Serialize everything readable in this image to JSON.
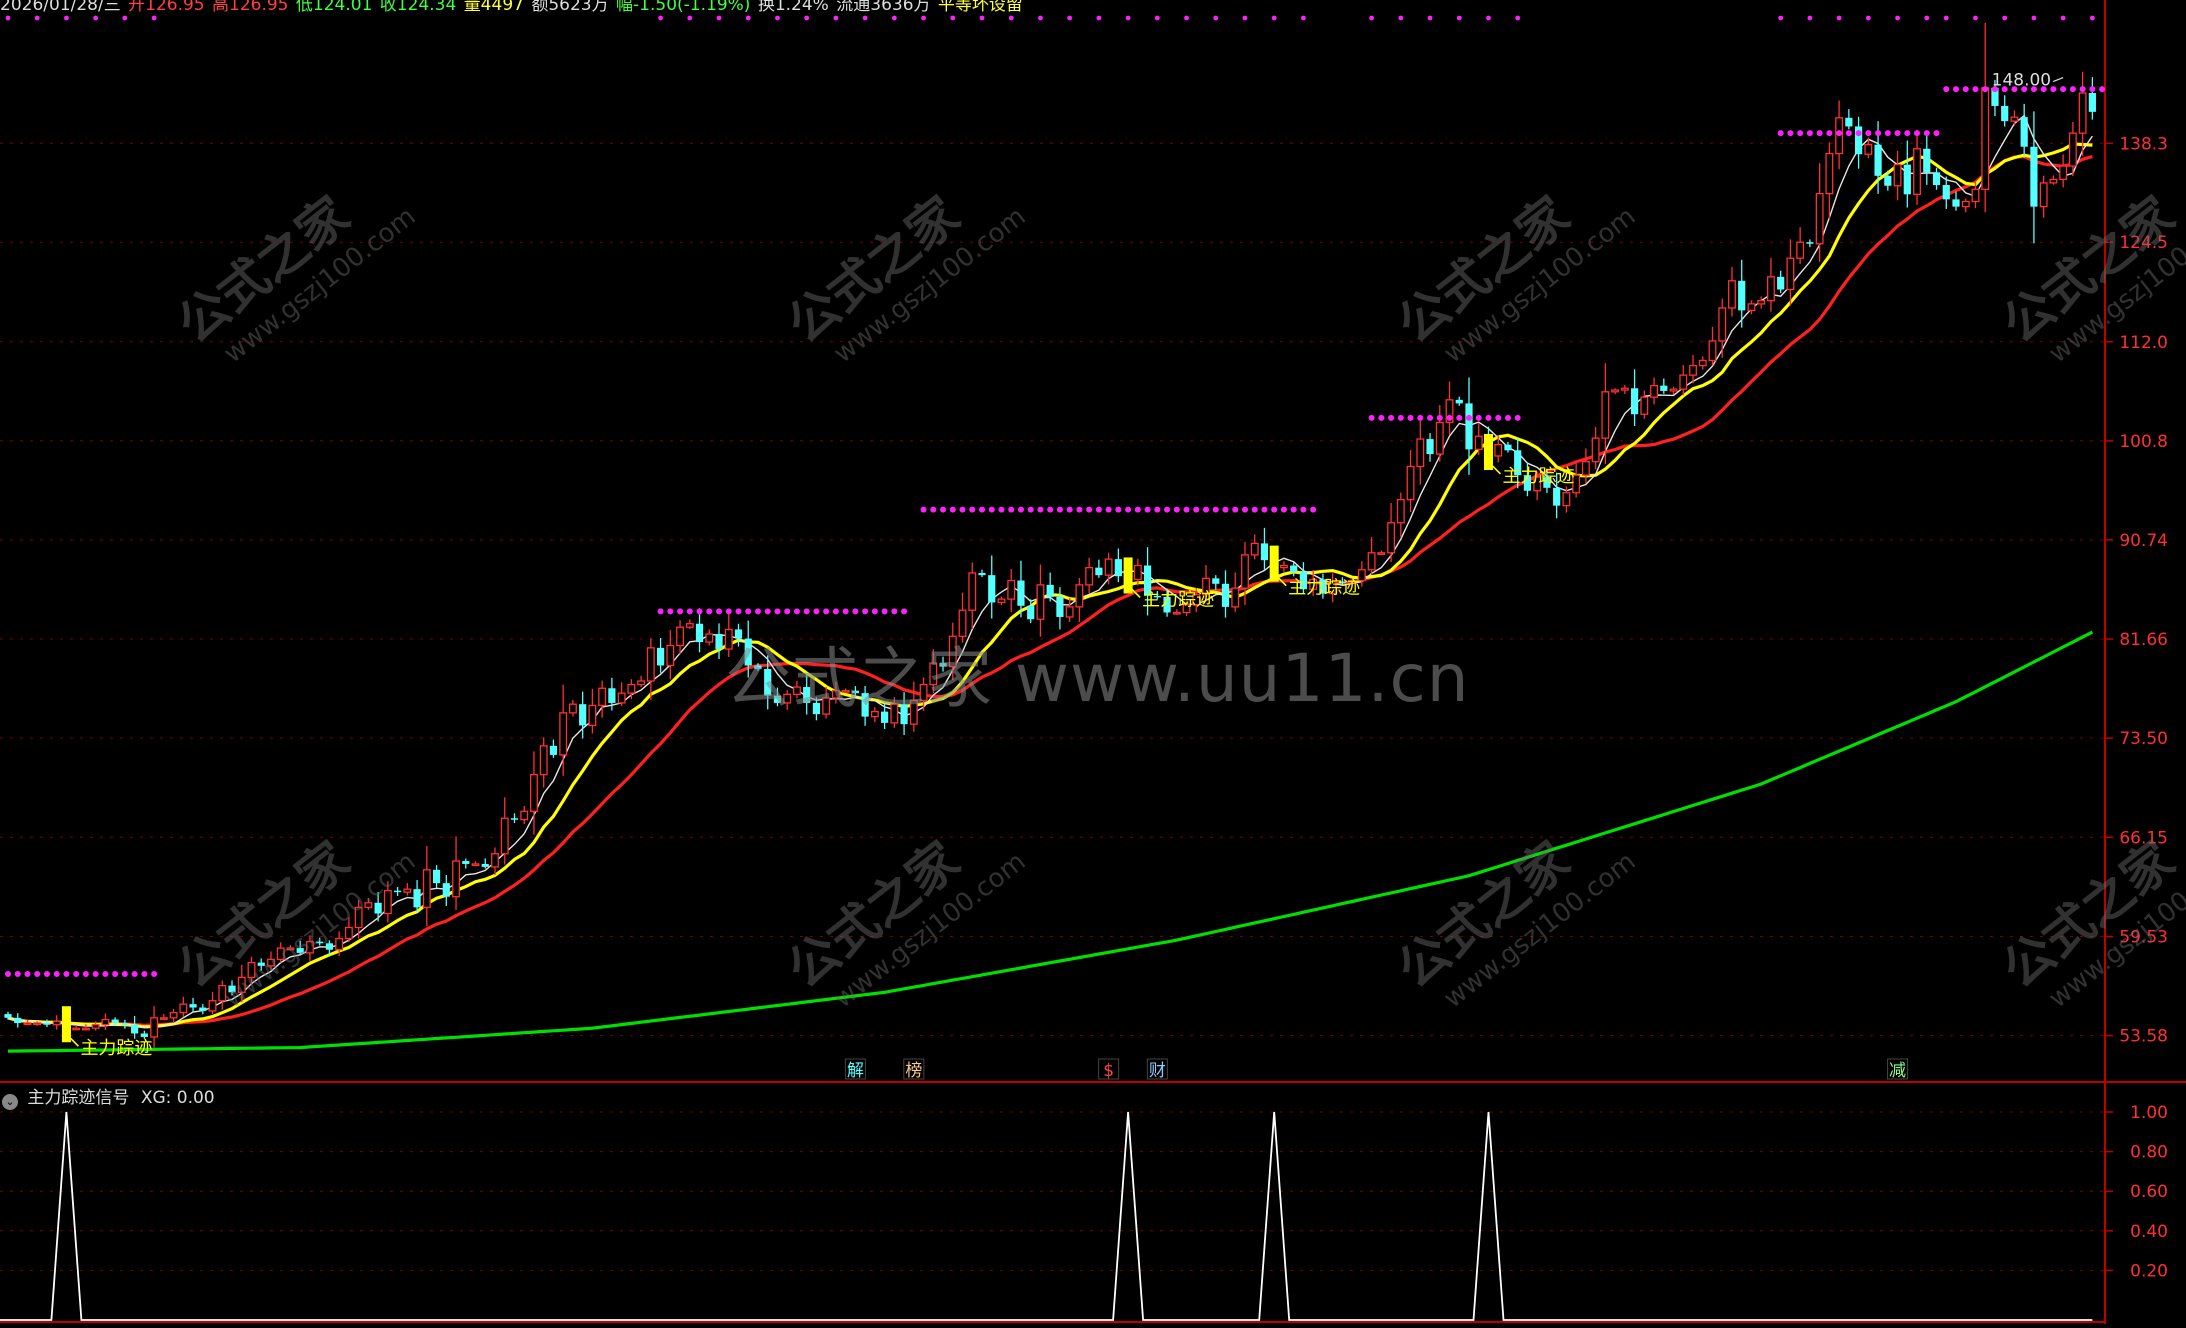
{
  "header": {
    "date": "2026/01/28/三",
    "open": "开126.95",
    "high": "高126.95",
    "low": "低124.01",
    "close": "收124.34",
    "volume": "量4497",
    "amount": "额5623万",
    "change": "幅-1.50(-1.19%)",
    "turnover": "换1.24%",
    "float": "流通3636万",
    "setting": "平等坏设留"
  },
  "colors": {
    "up": "#ff3030",
    "down": "#54ffff",
    "ma_white": "#e6e6e6",
    "ma_yellow": "#ffff00",
    "ma_red": "#ff2020",
    "ma_green": "#00e000",
    "resistance": "#ff20ff",
    "grid": "#7a0000",
    "axis": "#c00000",
    "label": "#ff3030",
    "signal": "#ffffff"
  },
  "main_panel": {
    "y_ticks": [
      "138.3",
      "124.5",
      "112.0",
      "100.8",
      "90.74",
      "81.66",
      "73.50",
      "66.15",
      "59.53",
      "53.58"
    ],
    "peak_label": "148.00",
    "event_marks": [
      {
        "text": "解",
        "color": "#5ff"
      },
      {
        "text": "榜",
        "color": "#fc8"
      },
      {
        "text": "$",
        "color": "#f44"
      },
      {
        "text": "财",
        "color": "#8cf"
      },
      {
        "text": "减",
        "color": "#8f8"
      }
    ],
    "signal_label": "主力踪迹"
  },
  "watermarks": {
    "center": "公式之家 www.uu11.cn",
    "cn": "公式之家",
    "url": "www.gszj100.com"
  },
  "sub_panel": {
    "title": "主力踪迹信号",
    "value_label": "XG: 0.00",
    "y_ticks": [
      "1.00",
      "0.80",
      "0.60",
      "0.40",
      "0.20"
    ]
  },
  "chart_data": [
    {
      "type": "candlestick",
      "title": "",
      "scale": "log",
      "ylim": [
        51.0,
        158.0
      ],
      "x": [
        0,
        1,
        2,
        3,
        4,
        5,
        6,
        7,
        8,
        9,
        10,
        11,
        12,
        13,
        14,
        15,
        16,
        17,
        18,
        19,
        20,
        21,
        22,
        23,
        24,
        25,
        26,
        27,
        28,
        29,
        30,
        31,
        32,
        33,
        34,
        35,
        36,
        37,
        38,
        39,
        40,
        41,
        42,
        43,
        44,
        45,
        46,
        47,
        48,
        49,
        50,
        51,
        52,
        53,
        54,
        55,
        56,
        57,
        58,
        59,
        60,
        61,
        62,
        63,
        64,
        65,
        66,
        67,
        68,
        69,
        70,
        71,
        72,
        73,
        74,
        75,
        76,
        77,
        78,
        79,
        80,
        81,
        82,
        83,
        84,
        85,
        86,
        87,
        88,
        89,
        90,
        91,
        92,
        93,
        94,
        95,
        96,
        97,
        98,
        99,
        100,
        101,
        102,
        103,
        104,
        105,
        106,
        107,
        108,
        109,
        110,
        111,
        112,
        113,
        114,
        115,
        116,
        117,
        118,
        119,
        120,
        121,
        122,
        123,
        124,
        125,
        126,
        127,
        128,
        129,
        130,
        131,
        132,
        133,
        134,
        135,
        136,
        137,
        138,
        139,
        140,
        141,
        142,
        143,
        144,
        145,
        146,
        147,
        148,
        149,
        150,
        151,
        152,
        153,
        154,
        155,
        156,
        157,
        158,
        159,
        160,
        161,
        162,
        163,
        164,
        165,
        166,
        167,
        168,
        169,
        170,
        171,
        172,
        173,
        174,
        175,
        176,
        177,
        178,
        179,
        180,
        181,
        182,
        183,
        184,
        185,
        186,
        187,
        188,
        189,
        190,
        191,
        192,
        193,
        194,
        195,
        196,
        197,
        198,
        199,
        200,
        201,
        202,
        203,
        204,
        205,
        206,
        207,
        208,
        209,
        210,
        211,
        212,
        213,
        214,
        215
      ],
      "close": [
        54.6,
        54.3,
        54.3,
        54.3,
        54.2,
        54.4,
        54.0,
        54.0,
        54.0,
        54.2,
        54.5,
        54.3,
        54.2,
        53.7,
        53.5,
        54.6,
        54.6,
        54.9,
        55.4,
        55.2,
        55.0,
        55.6,
        56.5,
        56.1,
        57.0,
        57.9,
        57.7,
        58.1,
        58.8,
        58.8,
        58.5,
        59.2,
        59.1,
        58.7,
        59.4,
        60.1,
        61.4,
        61.7,
        61.0,
        62.5,
        62.4,
        62.6,
        61.4,
        63.9,
        63.0,
        62.1,
        64.5,
        64.3,
        64.3,
        64.1,
        65.0,
        67.5,
        67.4,
        68.0,
        70.7,
        72.9,
        72.2,
        75.5,
        76.2,
        74.5,
        76.1,
        77.5,
        76.3,
        77.1,
        77.8,
        78.1,
        80.9,
        79.4,
        81.1,
        82.7,
        83.0,
        81.4,
        82.1,
        80.8,
        82.5,
        81.7,
        79.4,
        79.1,
        76.9,
        76.3,
        77.0,
        77.6,
        76.3,
        75.4,
        76.7,
        77.3,
        77.3,
        77.1,
        75.2,
        75.6,
        74.7,
        76.2,
        74.6,
        76.5,
        77.8,
        79.6,
        79.3,
        81.9,
        84.2,
        87.6,
        87.4,
        84.9,
        85.2,
        86.9,
        84.6,
        83.4,
        86.5,
        85.4,
        83.6,
        84.5,
        86.5,
        88.1,
        87.4,
        88.9,
        87.3,
        87.0,
        88.3,
        85.5,
        85.4,
        84.0,
        84.0,
        84.7,
        85.6,
        87.1,
        86.6,
        84.5,
        86.2,
        89.3,
        90.4,
        88.8,
        88.1,
        88.3,
        87.7,
        86.1,
        87.0,
        85.7,
        86.8,
        86.7,
        86.9,
        87.9,
        89.5,
        89.5,
        92.4,
        94.7,
        98.1,
        101.0,
        99.4,
        102.8,
        105.3,
        104.9,
        99.9,
        101.3,
        99.2,
        100.4,
        99.8,
        97.2,
        95.6,
        97.0,
        95.9,
        94.1,
        95.4,
        97.2,
        98.6,
        101.1,
        106.2,
        106.4,
        106.6,
        103.7,
        105.6,
        106.9,
        106.3,
        106.5,
        108.1,
        109.2,
        109.8,
        112.1,
        116.1,
        119.5,
        115.8,
        116.6,
        117.0,
        120.0,
        118.4,
        122.4,
        124.5,
        124.3,
        131.1,
        136.8,
        142.1,
        140.8,
        136.7,
        138.1,
        133.6,
        132.2,
        135.2,
        131.0,
        137.5,
        134.1,
        132.3,
        130.3,
        129.3,
        130.0,
        131.7,
        146.7,
        143.9,
        141.6,
        142.2,
        137.8,
        129.3,
        132.6,
        133.1,
        135.0,
        139.8,
        145.9,
        143.0
      ],
      "ma_white_period": 5,
      "ma_yellow_period": 10,
      "ma_red_period": 20,
      "ma_green": [
        [
          0,
          52.7
        ],
        [
          30,
          52.9
        ],
        [
          60,
          54.0
        ],
        [
          90,
          56.1
        ],
        [
          120,
          59.3
        ],
        [
          150,
          63.5
        ],
        [
          180,
          70.0
        ],
        [
          200,
          76.4
        ],
        [
          215,
          82.7
        ]
      ],
      "resistance_segments": [
        {
          "from": 0,
          "to": 15,
          "price": 57.2
        },
        {
          "from": 67,
          "to": 92,
          "price": 84.1
        },
        {
          "from": 94,
          "to": 134,
          "price": 93.7
        },
        {
          "from": 140,
          "to": 155,
          "price": 103.3
        },
        {
          "from": 182,
          "to": 198,
          "price": 139.8
        },
        {
          "from": 199,
          "to": 215,
          "price": 146.5
        }
      ],
      "signals": [
        6,
        115,
        130,
        152
      ],
      "peak": {
        "index": 211,
        "price": 148.0
      },
      "event_mark_indices": [
        87,
        93,
        113,
        118,
        194
      ]
    },
    {
      "type": "line",
      "title": "主力踪迹信号",
      "ylim": [
        0,
        1
      ],
      "signal_indices": [
        6,
        115,
        130,
        152
      ],
      "y_ticks": [
        1.0,
        0.8,
        0.6,
        0.4,
        0.2
      ]
    }
  ]
}
